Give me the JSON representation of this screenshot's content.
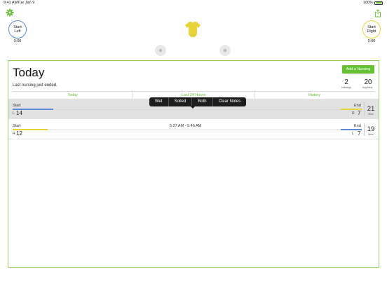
{
  "status_bar": {
    "time": "9:41 AM",
    "date": "Tue Jan 9",
    "battery": "100%"
  },
  "icons": {
    "settings": "gear-icon",
    "share": "share-icon",
    "baby": "onesie-icon"
  },
  "colors": {
    "accent": "#63c132",
    "left_side": "#5b8bd9",
    "right_side": "#e6d43a",
    "popup_bg": "#1d1d1d"
  },
  "controls": {
    "start_left": {
      "line1": "Start",
      "line2": "Left",
      "time": "0:00"
    },
    "start_right": {
      "line1": "Start",
      "line2": "Right",
      "time": "0:00"
    }
  },
  "panel": {
    "title": "Today",
    "status_message": "Last nursing just ended.",
    "add_button": "Add a Nursing",
    "stats": {
      "count": "2",
      "count_label": "Nursings",
      "avg": "20",
      "avg_label": "Avg Mins"
    }
  },
  "tabs": [
    {
      "label": "Today"
    },
    {
      "label": "Last 24 Hours"
    },
    {
      "label": "History"
    }
  ],
  "sessions": [
    {
      "start_label": "Start",
      "end_label": "End",
      "start_side": "L",
      "start_value": "14",
      "end_side": "R",
      "end_value": "7",
      "duration": "21",
      "duration_label": "Mins",
      "time_range": ""
    },
    {
      "start_label": "Start",
      "end_label": "End",
      "start_side": "R",
      "start_value": "12",
      "end_side": "L",
      "end_value": "7",
      "duration": "19",
      "duration_label": "Mins",
      "time_range": "5:27 AM - 5:46 AM"
    }
  ],
  "popup_menu": [
    {
      "label": "Wet"
    },
    {
      "label": "Soiled"
    },
    {
      "label": "Both"
    },
    {
      "label": "Clear Notes"
    }
  ]
}
